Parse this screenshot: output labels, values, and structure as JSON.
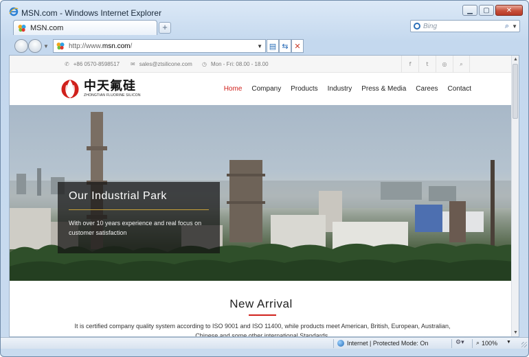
{
  "window": {
    "title": "MSN.com - Windows Internet Explorer",
    "controls": {
      "minimize": "▁",
      "maximize": "▢",
      "close": "✕"
    }
  },
  "tabs": [
    {
      "label": "MSN.com"
    }
  ],
  "newtab_label": "+",
  "search": {
    "placeholder": "Bing",
    "icon": "magnifier-icon"
  },
  "address": {
    "prefix": "http://www.",
    "domain": "msn.com",
    "suffix": "/"
  },
  "site": {
    "topbar": {
      "phone": "+86 0570-8598517",
      "email": "sales@ztsilicone.com",
      "hours": "Mon - Fri: 08.00 - 18.00",
      "social": [
        "f",
        "t",
        "◎",
        "⌕"
      ]
    },
    "logo": {
      "cn": "中天氟硅",
      "en": "ZHONGTIAN FLUORINE SILICON"
    },
    "nav": [
      {
        "label": "Home",
        "active": true
      },
      {
        "label": "Company",
        "active": false
      },
      {
        "label": "Products",
        "active": false
      },
      {
        "label": "Industry",
        "active": false
      },
      {
        "label": "Press & Media",
        "active": false
      },
      {
        "label": "Carees",
        "active": false
      },
      {
        "label": "Contact",
        "active": false
      }
    ],
    "hero": {
      "title": "Our Industrial Park",
      "text": "With over 10 years experience and real focus on customer satisfaction"
    },
    "arrival": {
      "title": "New Arrival",
      "text": "It is certified company quality system according to ISO 9001 and ISO 11400, while products meet American, British, European, Australian, Chinese and some other international Standards."
    },
    "colors": {
      "accent": "#d0211c",
      "caption_line": "#c9a23a"
    }
  },
  "statusbar": {
    "zone": "Internet | Protected Mode: On",
    "zoom": "100%"
  }
}
